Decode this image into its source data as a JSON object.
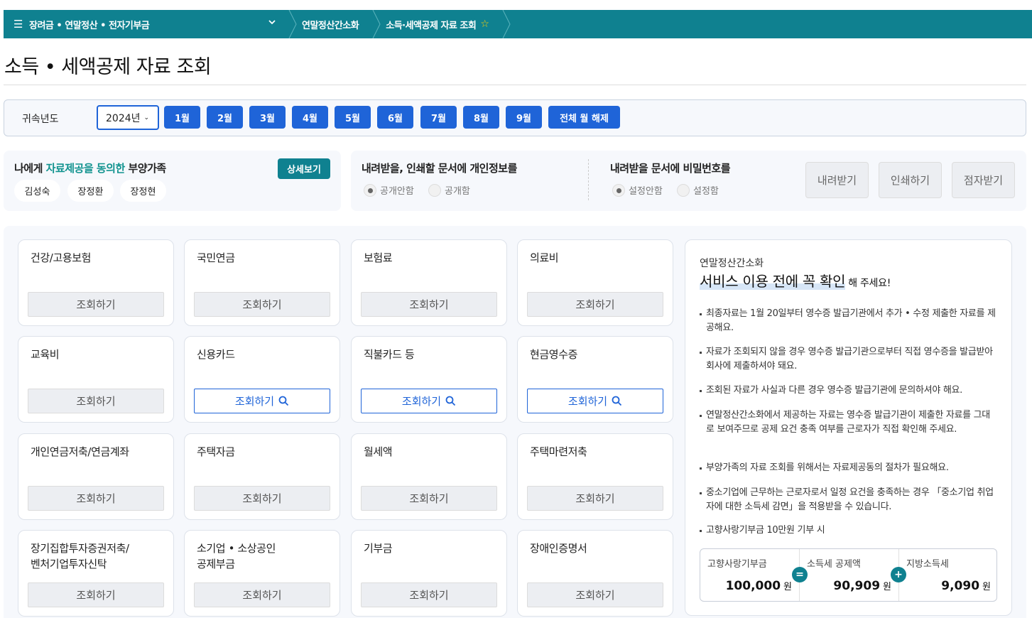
{
  "nav": {
    "menu_label": "장려금 • 연말정산 • 전자기부금",
    "crumbs": [
      "연말정산간소화",
      "소득·세액공제 자료 조회"
    ]
  },
  "page_title": "소득 • 세액공제 자료 조회",
  "year_bar": {
    "label": "귀속년도",
    "selected_year": "2024년",
    "months": [
      "1월",
      "2월",
      "3월",
      "4월",
      "5월",
      "6월",
      "7월",
      "8월",
      "9월"
    ],
    "clear_all": "전체 월 해제"
  },
  "consent": {
    "title_pre": "나에게 ",
    "title_highlight": "자료제공을 동의한",
    "title_post": " 부양가족",
    "detail_button": "상세보기",
    "dependents": [
      "김성숙",
      "장정환",
      "장정현"
    ]
  },
  "doc_options": {
    "privacy_title": "내려받을, 인쇄할 문서에 개인정보를",
    "privacy_options": [
      "공개안함",
      "공개함"
    ],
    "password_title": "내려받을 문서에 비밀번호를",
    "password_options": [
      "설정안함",
      "설정함"
    ],
    "actions": [
      "내려받기",
      "인쇄하기",
      "점자받기"
    ]
  },
  "categories": [
    {
      "title": "건강/고용보험",
      "button": "조회하기",
      "active": false
    },
    {
      "title": "국민연금",
      "button": "조회하기",
      "active": false
    },
    {
      "title": "보험료",
      "button": "조회하기",
      "active": false
    },
    {
      "title": "의료비",
      "button": "조회하기",
      "active": false
    },
    {
      "title": "교육비",
      "button": "조회하기",
      "active": false
    },
    {
      "title": "신용카드",
      "button": "조회하기",
      "active": true
    },
    {
      "title": "직불카드 등",
      "button": "조회하기",
      "active": true
    },
    {
      "title": "현금영수증",
      "button": "조회하기",
      "active": true
    },
    {
      "title": "개인연금저축/연금계좌",
      "button": "조회하기",
      "active": false
    },
    {
      "title": "주택자금",
      "button": "조회하기",
      "active": false
    },
    {
      "title": "월세액",
      "button": "조회하기",
      "active": false
    },
    {
      "title": "주택마련저축",
      "button": "조회하기",
      "active": false
    },
    {
      "title": "장기집합투자증권저축/\n벤처기업투자신탁",
      "button": "조회하기",
      "active": false
    },
    {
      "title": "소기업 • 소상공인\n공제부금",
      "button": "조회하기",
      "active": false
    },
    {
      "title": "기부금",
      "button": "조회하기",
      "active": false
    },
    {
      "title": "장애인증명서",
      "button": "조회하기",
      "active": false
    }
  ],
  "info": {
    "subtitle": "연말정산간소화",
    "headline": "서비스 이용 전에 꼭 확인",
    "headline_suffix": "해 주세요!",
    "notes": [
      "최종자료는 1월 20일부터 영수증 발급기관에서 추가 • 수정 제출한 자료를 제공해요.",
      "자료가 조회되지 않을 경우 영수증 발급기관으로부터 직접 영수증을 발급받아 회사에 제출하셔야 돼요.",
      "조회된 자료가 사실과 다른 경우 영수증 발급기관에 문의하셔야 해요.",
      "연말정산간소화에서 제공하는 자료는 영수증 발급기관이 제출한 자료를 그대로 보여주므로 공제 요건 충족 여부를 근로자가 직접 확인해 주세요.",
      "부양가족의 자료 조회를 위해서는 자료제공동의 절차가 필요해요.",
      "중소기업에 근무하는 근로자로서 일정 요건을 충족하는 경우 「중소기업 취업자에 대한 소득세 감면」을 적용받을 수 있습니다.",
      "고향사랑기부금 10만원 기부 시"
    ],
    "calc": [
      {
        "label": "고향사랑기부금",
        "value": "100,000",
        "unit": "원"
      },
      {
        "label": "소득세 공제액",
        "value": "90,909",
        "unit": "원"
      },
      {
        "label": "지방소득세",
        "value": "9,090",
        "unit": "원"
      }
    ],
    "operators": [
      "=",
      "+"
    ]
  },
  "colors": {
    "teal": "#0f8190",
    "blue": "#1f64d8",
    "highlight": "#11938f",
    "panel_bg": "#f6f8fc"
  }
}
